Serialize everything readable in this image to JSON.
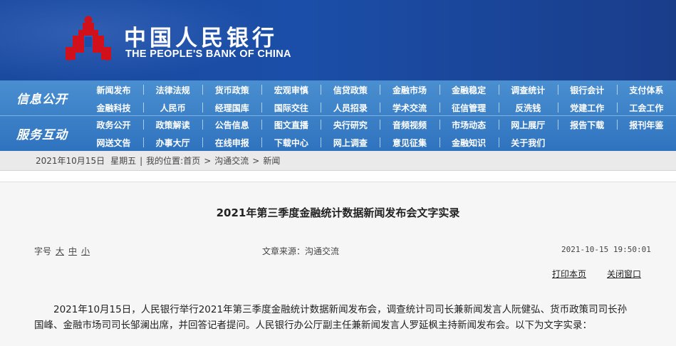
{
  "header": {
    "cn_name": "中国人民银行",
    "en_name": "THE PEOPLE'S BANK OF CHINA"
  },
  "nav": {
    "section1_label": "信息公开",
    "section2_label": "服务互动",
    "rows": [
      [
        "新闻发布",
        "法律法规",
        "货币政策",
        "宏观审慎",
        "信贷政策",
        "金融市场",
        "金融稳定",
        "调查统计",
        "银行会计",
        "支付体系"
      ],
      [
        "金融科技",
        "人民币",
        "经理国库",
        "国际交往",
        "人员招录",
        "学术交流",
        "征信管理",
        "反洗钱",
        "党建工作",
        "工会工作"
      ],
      [
        "政务公开",
        "政策解读",
        "公告信息",
        "图文直播",
        "央行研究",
        "音频视频",
        "市场动态",
        "网上展厅",
        "报告下载",
        "报刊年鉴"
      ],
      [
        "网送文告",
        "办事大厅",
        "在线申报",
        "下载中心",
        "网上调查",
        "意见征集",
        "金融知识",
        "关于我们"
      ]
    ]
  },
  "breadcrumb": {
    "date": "2021年10月15日",
    "weekday": "星期五",
    "location_label": "我的位置:",
    "home": "首页",
    "level1": "沟通交流",
    "level2": "新闻",
    "separator": ">"
  },
  "article": {
    "title": "2021年第三季度金融统计数据新闻发布会文字实录",
    "font_size_label": "字号",
    "font_sizes": [
      "大",
      "中",
      "小"
    ],
    "source": "文章来源：沟通交流",
    "timestamp": "2021-10-15  19:50:01",
    "print_label": "打印本页",
    "close_label": "关闭窗口",
    "paragraph_lines": [
      "2021年10月15日，人民银行举行2021年第三季度金融统计数据新闻发布会，调查统计司司长兼新闻发言人阮健弘、货币政策司司长孙",
      "国峰、金融市场司司长邹澜出席，并回答记者提问。人民银行办公厅副主任兼新闻发言人罗延枫主持新闻发布会。以下为文字实录："
    ]
  },
  "colors": {
    "banner": "#1b4ea8",
    "nav": "#3a80c8",
    "logo_red": "#d0111b"
  }
}
